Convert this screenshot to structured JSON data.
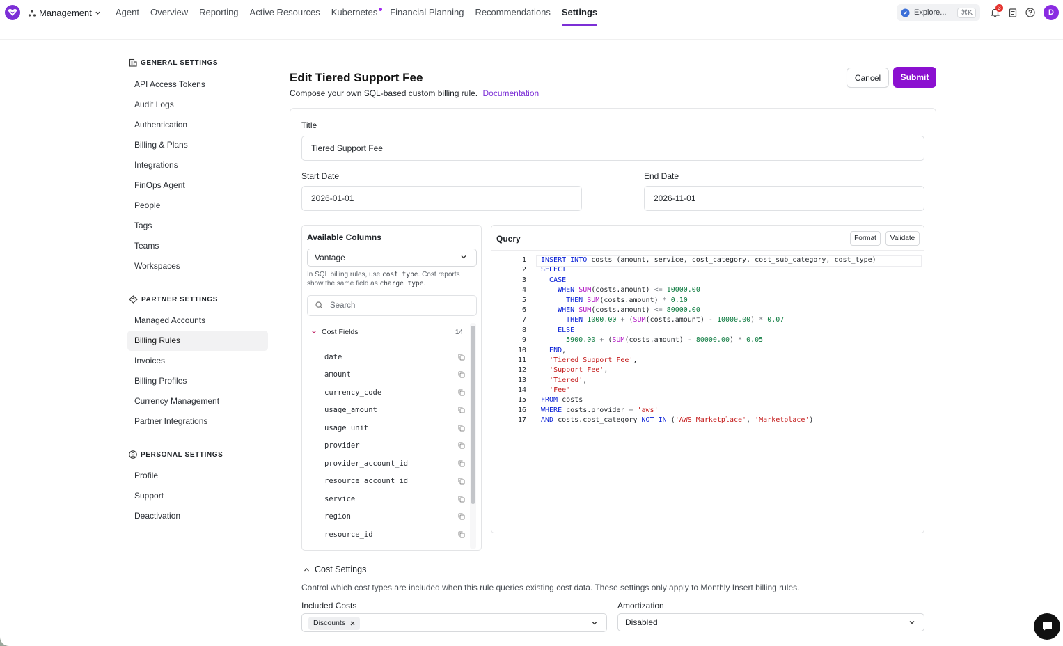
{
  "topnav": {
    "workspace": "Management",
    "items": [
      {
        "label": "Agent"
      },
      {
        "label": "Overview"
      },
      {
        "label": "Reporting"
      },
      {
        "label": "Active Resources"
      },
      {
        "label": "Kubernetes"
      },
      {
        "label": "Financial Planning"
      },
      {
        "label": "Recommendations"
      },
      {
        "label": "Settings"
      }
    ],
    "explore_label": "Explore...",
    "explore_shortcut": "⌘K",
    "notification_count": "3",
    "avatar_initial": "D"
  },
  "sidebar": {
    "general_heading": "GENERAL SETTINGS",
    "general_items": [
      "API Access Tokens",
      "Audit Logs",
      "Authentication",
      "Billing & Plans",
      "Integrations",
      "FinOps Agent",
      "People",
      "Tags",
      "Teams",
      "Workspaces"
    ],
    "partner_heading": "PARTNER SETTINGS",
    "partner_items": [
      "Managed Accounts",
      "Billing Rules",
      "Invoices",
      "Billing Profiles",
      "Currency Management",
      "Partner Integrations"
    ],
    "personal_heading": "PERSONAL SETTINGS",
    "personal_items": [
      "Profile",
      "Support",
      "Deactivation"
    ]
  },
  "main": {
    "title": "Edit Tiered Support Fee",
    "subtitle": "Compose your own SQL-based custom billing rule.",
    "doc_link": "Documentation",
    "cancel_label": "Cancel",
    "submit_label": "Submit",
    "title_label": "Title",
    "title_value": "Tiered Support Fee",
    "start_label": "Start Date",
    "start_value": "2026-01-01",
    "end_label": "End Date",
    "end_value": "2026-11-01"
  },
  "available": {
    "heading": "Available Columns",
    "source": "Vantage",
    "hint_pre": "In SQL billing rules, use ",
    "hint_code1": "cost_type",
    "hint_mid": ". Cost reports show the same field as ",
    "hint_code2": "charge_type",
    "hint_post": ".",
    "search_placeholder": "Search",
    "group_label": "Cost Fields",
    "group_count": "14",
    "fields": [
      "date",
      "amount",
      "currency_code",
      "usage_amount",
      "usage_unit",
      "provider",
      "provider_account_id",
      "resource_account_id",
      "service",
      "region",
      "resource_id"
    ]
  },
  "query": {
    "heading": "Query",
    "format_label": "Format",
    "validate_label": "Validate",
    "line_numbers": [
      "1",
      "2",
      "3",
      "4",
      "5",
      "6",
      "7",
      "8",
      "9",
      "10",
      "11",
      "12",
      "13",
      "14",
      "15",
      "16",
      "17"
    ],
    "lines": [
      "INSERT INTO costs (amount, service, cost_category, cost_sub_category, cost_type)",
      "SELECT",
      "  CASE",
      "    WHEN SUM(costs.amount) <= 10000.00",
      "      THEN SUM(costs.amount) * 0.10",
      "    WHEN SUM(costs.amount) <= 80000.00",
      "      THEN 1000.00 + (SUM(costs.amount) - 10000.00) * 0.07",
      "    ELSE",
      "      5900.00 + (SUM(costs.amount) - 80000.00) * 0.05",
      "  END,",
      "  'Tiered Support Fee',",
      "  'Support Fee',",
      "  'Tiered',",
      "  'Fee'",
      "FROM costs",
      "WHERE costs.provider = 'aws'",
      "AND costs.cost_category NOT IN ('AWS Marketplace', 'Marketplace')"
    ]
  },
  "cost_settings": {
    "heading": "Cost Settings",
    "description": "Control which cost types are included when this rule queries existing cost data. These settings only apply to Monthly Insert billing rules.",
    "included_label": "Included Costs",
    "included_chip": "Discounts",
    "amort_label": "Amortization",
    "amort_value": "Disabled"
  },
  "colors": {
    "accent": "#7c2fd6",
    "submit": "#8b10d0",
    "keyword": "#0a21d6",
    "function": "#b218c4",
    "number": "#0b7a3e",
    "string": "#c41a1a"
  }
}
